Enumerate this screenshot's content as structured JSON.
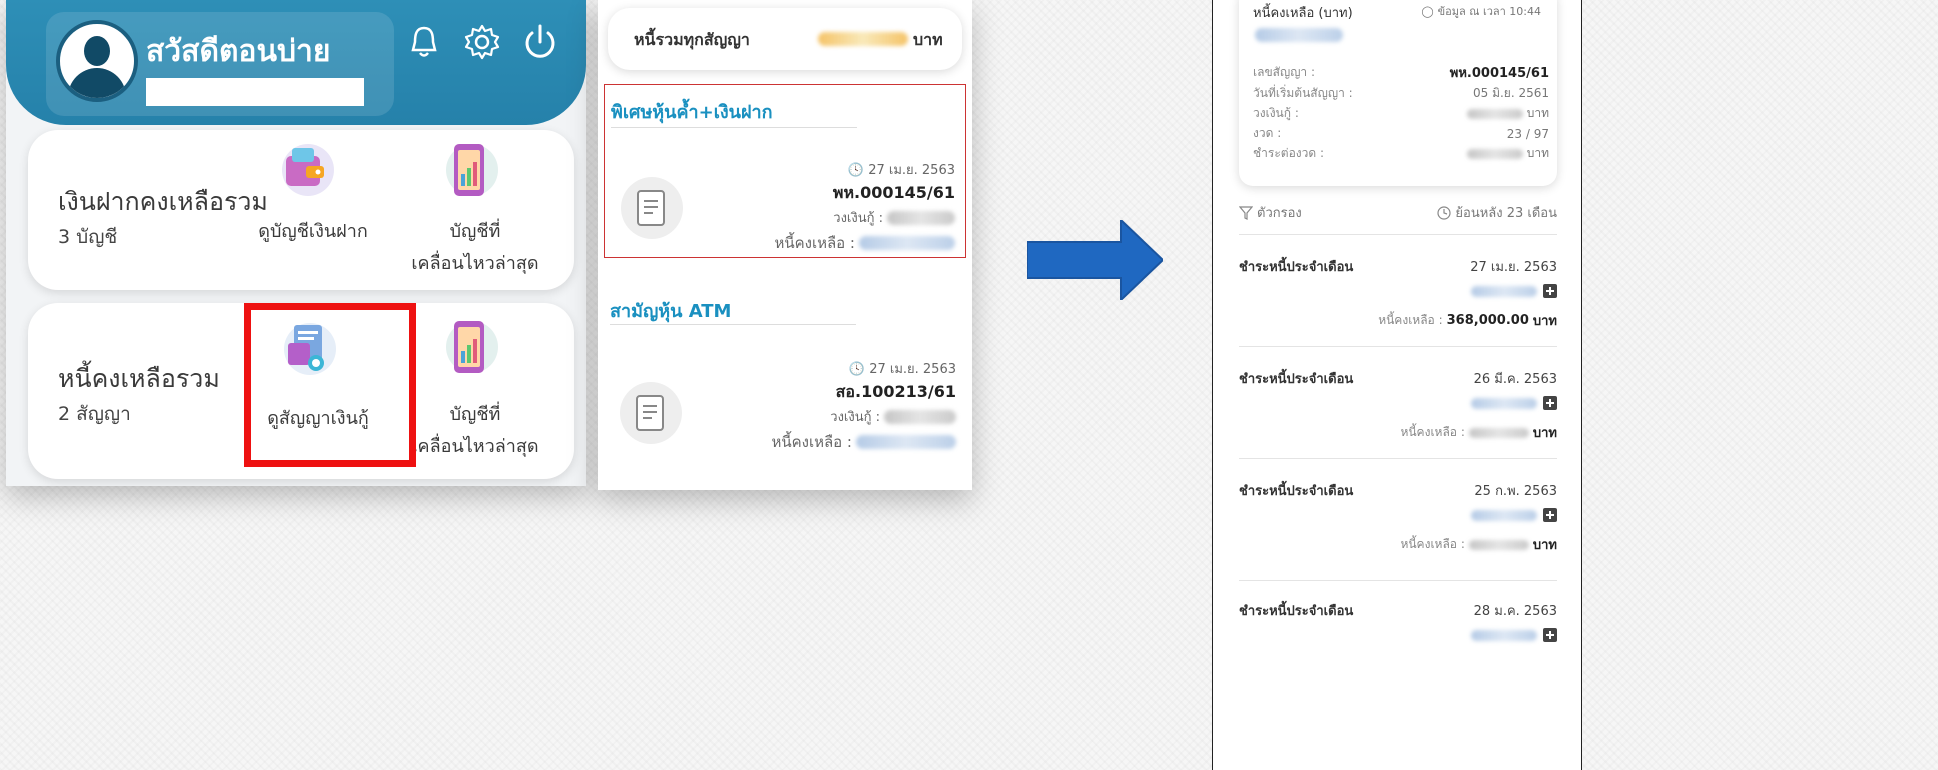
{
  "panel1": {
    "greeting": "สวัสดีตอนบ่าย",
    "deposit_card": {
      "title": "เงินฝากคงเหลือรวม",
      "count": "3 บัญชี",
      "link_view": "ดูบัญชีเงินฝาก",
      "link_recent_1": "บัญชีที่",
      "link_recent_2": "เคลื่อนไหวล่าสุด"
    },
    "debt_card": {
      "title": "หนี้คงเหลือรวม",
      "count": "2 สัญญา",
      "link_view": "ดูสัญญาเงินกู้",
      "link_recent_1": "บัญชีที่",
      "link_recent_2": "เคลื่อนไหวล่าสุด"
    }
  },
  "panel2": {
    "total_label": "หนี้รวมทุกสัญญา",
    "total_unit": "บาท",
    "contracts": [
      {
        "name": "พิเศษหุ้นค้ำ+เงินฝาก",
        "date": "27 เม.ย. 2563",
        "number": "พห.000145/61",
        "limit_label": "วงเงินกู้ :",
        "remain_label": "หนี้คงเหลือ :"
      },
      {
        "name": "สามัญหุ้น ATM",
        "date": "27 เม.ย. 2563",
        "number": "สอ.100213/61",
        "limit_label": "วงเงินกู้ :",
        "remain_label": "หนี้คงเหลือ :"
      }
    ]
  },
  "panel3": {
    "balance_label": "หนี้คงเหลือ (บาท)",
    "balance_time": "ข้อมูล ณ เวลา 10:44",
    "rows": [
      {
        "label": "เลขสัญญา :",
        "value": "พห.000145/61"
      },
      {
        "label": "วันที่เริ่มต้นสัญญา :",
        "value": "05 มิ.ย. 2561"
      },
      {
        "label": "วงเงินกู้ :",
        "value": "บาท"
      },
      {
        "label": "งวด :",
        "value": "23 / 97"
      },
      {
        "label": "ชำระต่องวด :",
        "value": "บาท"
      }
    ],
    "filter_label": "ตัวกรอง",
    "back_label": "ย้อนหลัง 23 เดือน",
    "payments": [
      {
        "title": "ชำระหนี้ประจำเดือน",
        "date": "27 เม.ย. 2563",
        "remain_label": "หนี้คงเหลือ :",
        "remain_value": "368,000.00",
        "unit": "บาท"
      },
      {
        "title": "ชำระหนี้ประจำเดือน",
        "date": "26 มี.ค. 2563",
        "remain_label": "หนี้คงเหลือ :",
        "remain_value": "",
        "unit": "บาท"
      },
      {
        "title": "ชำระหนี้ประจำเดือน",
        "date": "25 ก.พ. 2563",
        "remain_label": "หนี้คงเหลือ :",
        "remain_value": "",
        "unit": "บาท"
      },
      {
        "title": "ชำระหนี้ประจำเดือน",
        "date": "28 ม.ค. 2563",
        "remain_label": "",
        "remain_value": "",
        "unit": ""
      }
    ]
  },
  "colors": {
    "header_blue": "#2e8fb7",
    "accent_blue": "#1a90c0",
    "highlight_red": "#ee1111",
    "arrow_blue": "#1f68c1"
  }
}
